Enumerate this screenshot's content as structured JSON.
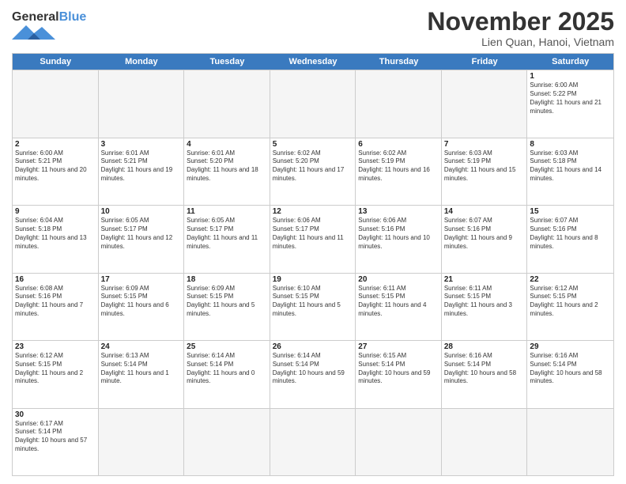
{
  "header": {
    "logo_general": "General",
    "logo_blue": "Blue",
    "month_year": "November 2025",
    "location": "Lien Quan, Hanoi, Vietnam"
  },
  "weekdays": [
    "Sunday",
    "Monday",
    "Tuesday",
    "Wednesday",
    "Thursday",
    "Friday",
    "Saturday"
  ],
  "weeks": [
    [
      {
        "day": "",
        "info": "",
        "empty": true
      },
      {
        "day": "",
        "info": "",
        "empty": true
      },
      {
        "day": "",
        "info": "",
        "empty": true
      },
      {
        "day": "",
        "info": "",
        "empty": true
      },
      {
        "day": "",
        "info": "",
        "empty": true
      },
      {
        "day": "",
        "info": "",
        "empty": true
      },
      {
        "day": "1",
        "info": "Sunrise: 6:00 AM\nSunset: 5:22 PM\nDaylight: 11 hours and 21 minutes.",
        "empty": false
      }
    ],
    [
      {
        "day": "2",
        "info": "Sunrise: 6:00 AM\nSunset: 5:21 PM\nDaylight: 11 hours and 20 minutes.",
        "empty": false
      },
      {
        "day": "3",
        "info": "Sunrise: 6:01 AM\nSunset: 5:21 PM\nDaylight: 11 hours and 19 minutes.",
        "empty": false
      },
      {
        "day": "4",
        "info": "Sunrise: 6:01 AM\nSunset: 5:20 PM\nDaylight: 11 hours and 18 minutes.",
        "empty": false
      },
      {
        "day": "5",
        "info": "Sunrise: 6:02 AM\nSunset: 5:20 PM\nDaylight: 11 hours and 17 minutes.",
        "empty": false
      },
      {
        "day": "6",
        "info": "Sunrise: 6:02 AM\nSunset: 5:19 PM\nDaylight: 11 hours and 16 minutes.",
        "empty": false
      },
      {
        "day": "7",
        "info": "Sunrise: 6:03 AM\nSunset: 5:19 PM\nDaylight: 11 hours and 15 minutes.",
        "empty": false
      },
      {
        "day": "8",
        "info": "Sunrise: 6:03 AM\nSunset: 5:18 PM\nDaylight: 11 hours and 14 minutes.",
        "empty": false
      }
    ],
    [
      {
        "day": "9",
        "info": "Sunrise: 6:04 AM\nSunset: 5:18 PM\nDaylight: 11 hours and 13 minutes.",
        "empty": false
      },
      {
        "day": "10",
        "info": "Sunrise: 6:05 AM\nSunset: 5:17 PM\nDaylight: 11 hours and 12 minutes.",
        "empty": false
      },
      {
        "day": "11",
        "info": "Sunrise: 6:05 AM\nSunset: 5:17 PM\nDaylight: 11 hours and 11 minutes.",
        "empty": false
      },
      {
        "day": "12",
        "info": "Sunrise: 6:06 AM\nSunset: 5:17 PM\nDaylight: 11 hours and 11 minutes.",
        "empty": false
      },
      {
        "day": "13",
        "info": "Sunrise: 6:06 AM\nSunset: 5:16 PM\nDaylight: 11 hours and 10 minutes.",
        "empty": false
      },
      {
        "day": "14",
        "info": "Sunrise: 6:07 AM\nSunset: 5:16 PM\nDaylight: 11 hours and 9 minutes.",
        "empty": false
      },
      {
        "day": "15",
        "info": "Sunrise: 6:07 AM\nSunset: 5:16 PM\nDaylight: 11 hours and 8 minutes.",
        "empty": false
      }
    ],
    [
      {
        "day": "16",
        "info": "Sunrise: 6:08 AM\nSunset: 5:16 PM\nDaylight: 11 hours and 7 minutes.",
        "empty": false
      },
      {
        "day": "17",
        "info": "Sunrise: 6:09 AM\nSunset: 5:15 PM\nDaylight: 11 hours and 6 minutes.",
        "empty": false
      },
      {
        "day": "18",
        "info": "Sunrise: 6:09 AM\nSunset: 5:15 PM\nDaylight: 11 hours and 5 minutes.",
        "empty": false
      },
      {
        "day": "19",
        "info": "Sunrise: 6:10 AM\nSunset: 5:15 PM\nDaylight: 11 hours and 5 minutes.",
        "empty": false
      },
      {
        "day": "20",
        "info": "Sunrise: 6:11 AM\nSunset: 5:15 PM\nDaylight: 11 hours and 4 minutes.",
        "empty": false
      },
      {
        "day": "21",
        "info": "Sunrise: 6:11 AM\nSunset: 5:15 PM\nDaylight: 11 hours and 3 minutes.",
        "empty": false
      },
      {
        "day": "22",
        "info": "Sunrise: 6:12 AM\nSunset: 5:15 PM\nDaylight: 11 hours and 2 minutes.",
        "empty": false
      }
    ],
    [
      {
        "day": "23",
        "info": "Sunrise: 6:12 AM\nSunset: 5:15 PM\nDaylight: 11 hours and 2 minutes.",
        "empty": false
      },
      {
        "day": "24",
        "info": "Sunrise: 6:13 AM\nSunset: 5:14 PM\nDaylight: 11 hours and 1 minute.",
        "empty": false
      },
      {
        "day": "25",
        "info": "Sunrise: 6:14 AM\nSunset: 5:14 PM\nDaylight: 11 hours and 0 minutes.",
        "empty": false
      },
      {
        "day": "26",
        "info": "Sunrise: 6:14 AM\nSunset: 5:14 PM\nDaylight: 10 hours and 59 minutes.",
        "empty": false
      },
      {
        "day": "27",
        "info": "Sunrise: 6:15 AM\nSunset: 5:14 PM\nDaylight: 10 hours and 59 minutes.",
        "empty": false
      },
      {
        "day": "28",
        "info": "Sunrise: 6:16 AM\nSunset: 5:14 PM\nDaylight: 10 hours and 58 minutes.",
        "empty": false
      },
      {
        "day": "29",
        "info": "Sunrise: 6:16 AM\nSunset: 5:14 PM\nDaylight: 10 hours and 58 minutes.",
        "empty": false
      }
    ],
    [
      {
        "day": "30",
        "info": "Sunrise: 6:17 AM\nSunset: 5:14 PM\nDaylight: 10 hours and 57 minutes.",
        "empty": false
      },
      {
        "day": "",
        "info": "",
        "empty": true
      },
      {
        "day": "",
        "info": "",
        "empty": true
      },
      {
        "day": "",
        "info": "",
        "empty": true
      },
      {
        "day": "",
        "info": "",
        "empty": true
      },
      {
        "day": "",
        "info": "",
        "empty": true
      },
      {
        "day": "",
        "info": "",
        "empty": true
      }
    ]
  ]
}
